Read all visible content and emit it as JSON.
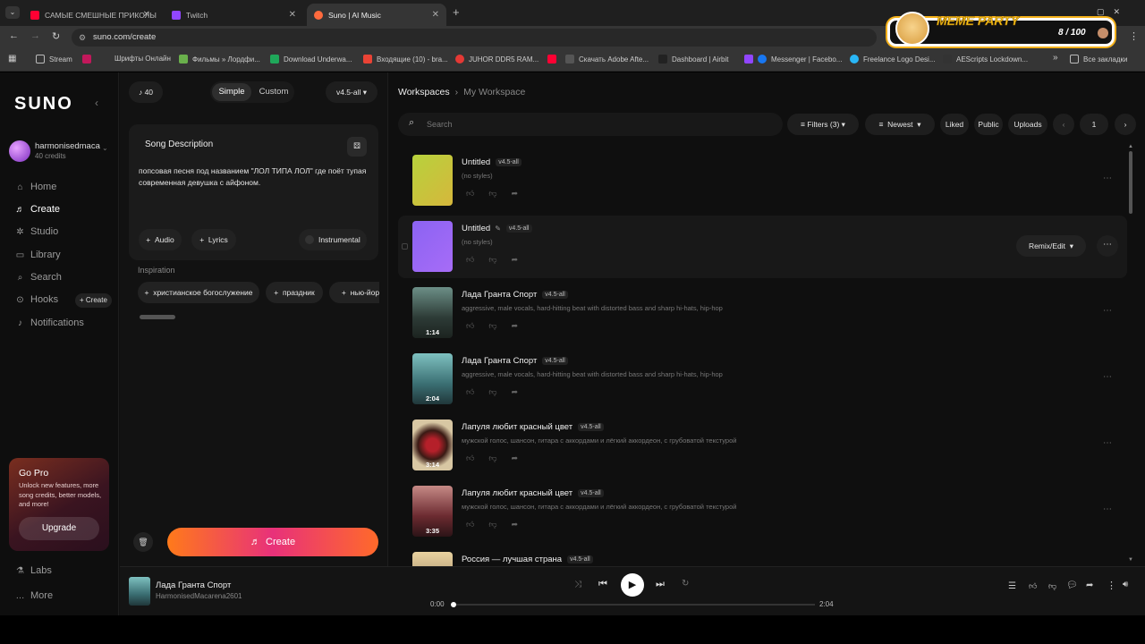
{
  "browser": {
    "tabs": [
      {
        "label": "САМЫЕ СМЕШНЫЕ ПРИКОЛЫ",
        "color": "#ff0033"
      },
      {
        "label": "Twitch",
        "color": "#9146ff"
      },
      {
        "label": "Suno | AI Music",
        "color": "#ff6a3d"
      }
    ],
    "url": "suno.com/create",
    "bookmarks": [
      "Stream",
      "Шрифты Онлайн",
      "Фильмы » Лордфи...",
      "Download Underwa...",
      "Входящие (10) - bra...",
      "JUHOR DDR5 RAM...",
      "Скачать Adobe Afte...",
      "Dashboard | Airbit",
      "Messenger | Facebo...",
      "Freelance Logo Desi...",
      "AEScripts Lockdown..."
    ],
    "bookmarks_more": "»",
    "all_bookmarks": "Все закладки"
  },
  "overlay": {
    "title": "MEME PARTY",
    "counter": "8 / 100"
  },
  "sidebar": {
    "logo": "SUNO",
    "user": {
      "name": "harmonisedmaca",
      "credits": "40 credits"
    },
    "nav": [
      {
        "label": "Home",
        "icon": "home-icon",
        "glyph": "⌂"
      },
      {
        "label": "Create",
        "icon": "music-note-icon",
        "glyph": "♬",
        "active": true
      },
      {
        "label": "Studio",
        "icon": "studio-icon",
        "glyph": "✲"
      },
      {
        "label": "Library",
        "icon": "library-icon",
        "glyph": "▭"
      },
      {
        "label": "Search",
        "icon": "search-icon",
        "glyph": "⌕"
      },
      {
        "label": "Hooks",
        "icon": "hooks-icon",
        "glyph": "⊙"
      },
      {
        "label": "Notifications",
        "icon": "bell-icon",
        "glyph": "♪"
      }
    ],
    "hooks_create": "+ Create",
    "gopro": {
      "title": "Go Pro",
      "text": "Unlock new features, more song credits, better models, and more!",
      "button": "Upgrade"
    },
    "labs": "Labs",
    "more": "More"
  },
  "panel": {
    "credits": "40",
    "mode_simple": "Simple",
    "mode_custom": "Custom",
    "version": "v4.5-all",
    "desc_title": "Song Description",
    "desc_text": "попсовая песня под названием \"ЛОЛ ТИПА ЛОЛ\" где поёт тупая современная девушка с айфоном.",
    "audio": "Audio",
    "lyrics": "Lyrics",
    "instrumental": "Instrumental",
    "inspiration": "Inspiration",
    "chips": [
      "христианское богослужение",
      "праздник",
      "нью-йор"
    ],
    "create": "Create"
  },
  "main": {
    "breadcrumb": [
      "Workspaces",
      "My Workspace"
    ],
    "search_placeholder": "Search",
    "filters": "Filters (3)",
    "sort": "Newest",
    "liked": "Liked",
    "public": "Public",
    "uploads": "Uploads",
    "page": "1",
    "remix": "Remix/Edit",
    "songs": [
      {
        "title": "Untitled",
        "version": "v4.5-all",
        "styles": "(no styles)",
        "duration": "",
        "thumb": "linear-gradient(135deg,#b7d23c,#d6b73c)"
      },
      {
        "title": "Untitled",
        "version": "v4.5-all",
        "styles": "(no styles)",
        "duration": "",
        "thumb": "linear-gradient(135deg,#8b63f2,#a76cf7)",
        "hover": true
      },
      {
        "title": "Лада Гранта Спорт",
        "version": "v4.5-all",
        "styles": "aggressive, male vocals, hard-hitting beat with distorted bass and sharp hi-hats, hip-hop",
        "duration": "1:14",
        "thumb": "linear-gradient(180deg,#6c8f87,#2d3b36 60%,#1c2320)"
      },
      {
        "title": "Лада Гранта Спорт",
        "version": "v4.5-all",
        "styles": "aggressive, male vocals, hard-hitting beat with distorted bass and sharp hi-hats, hip-hop",
        "duration": "2:04",
        "thumb": "linear-gradient(180deg,#7ec1c0,#3b6f73 60%,#20373a)"
      },
      {
        "title": "Лапуля любит красный цвет",
        "version": "v4.5-all",
        "styles": "мужской голос, шансон, гитара с аккордами и лёгкий аккордеон, с грубоватой текстурой",
        "duration": "3:14",
        "thumb": "radial-gradient(circle,#b5202a 20%,#3a1a14 45%,#d8c7a3 70%)"
      },
      {
        "title": "Лапуля любит красный цвет",
        "version": "v4.5-all",
        "styles": "мужской голос, шансон, гитара с аккордами и лёгкий аккордеон, с грубоватой текстурой",
        "duration": "3:35",
        "thumb": "linear-gradient(180deg,#c68a86,#6b2a30 60%,#2c1417)"
      },
      {
        "title": "Россия — лучшая страна",
        "version": "v4.5-all",
        "styles": "",
        "duration": "",
        "thumb": "linear-gradient(180deg,#e9d3a0,#8a6e54)"
      }
    ]
  },
  "player": {
    "title": "Лада Гранта Спорт",
    "artist": "HarmonisedMacarena2601",
    "current": "0:00",
    "total": "2:04",
    "progress": 0.0
  }
}
